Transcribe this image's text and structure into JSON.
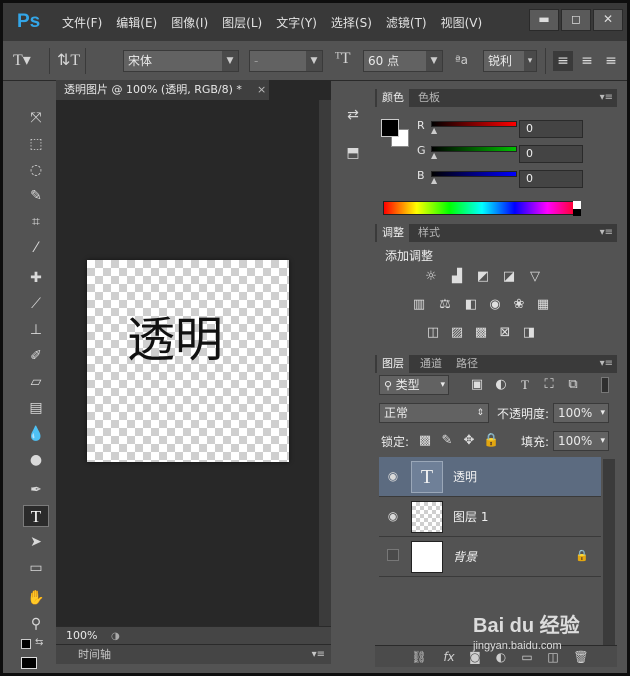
{
  "app": {
    "logo": "Ps"
  },
  "menu": [
    "文件(F)",
    "编辑(E)",
    "图像(I)",
    "图层(L)",
    "文字(Y)",
    "选择(S)",
    "滤镜(T)",
    "视图(V)"
  ],
  "window_controls": {
    "minimize": "▬",
    "restore": "◻",
    "close": "✕"
  },
  "options": {
    "font_family": "宋体",
    "font_style": "-",
    "font_size": "60 点",
    "antialias_icon": "ªa",
    "antialias": "锐利"
  },
  "document": {
    "tab_title": "透明图片 @ 100% (透明, RGB/8) *",
    "close": "×",
    "canvas_text": "透明",
    "zoom": "100%"
  },
  "timeline": {
    "label": "时间轴"
  },
  "color_panel": {
    "tabs": [
      "颜色",
      "色板"
    ],
    "active_tab": 0,
    "channels": [
      {
        "label": "R",
        "value": "0",
        "color": "#ff0000"
      },
      {
        "label": "G",
        "value": "0",
        "color": "#00c000"
      },
      {
        "label": "B",
        "value": "0",
        "color": "#0000ff"
      }
    ],
    "foreground": "#000000",
    "background": "#ffffff"
  },
  "adjust_panel": {
    "tabs": [
      "调整",
      "样式"
    ],
    "active_tab": 0,
    "title": "添加调整",
    "row1": [
      "sun-icon",
      "levels-icon",
      "curves-icon",
      "exposure-icon",
      "triangle-down-icon"
    ],
    "row2": [
      "hue-icon",
      "balance-icon",
      "bw-icon",
      "camera-icon",
      "mixer-icon",
      "grid-icon"
    ],
    "row3": [
      "invert-icon",
      "posterize-icon",
      "threshold-icon",
      "selective-icon",
      "gradient-map-icon"
    ]
  },
  "layers_panel": {
    "tabs": [
      "图层",
      "通道",
      "路径"
    ],
    "active_tab": 0,
    "filter_kind": "类型",
    "blend_mode": "正常",
    "opacity_label": "不透明度:",
    "opacity": "100%",
    "lock_label": "锁定:",
    "fill_label": "填充:",
    "fill": "100%",
    "layers": [
      {
        "name": "透明",
        "type": "text",
        "visible": true,
        "selected": true,
        "thumb_label": "T"
      },
      {
        "name": "图层 1",
        "type": "transparent",
        "visible": true,
        "selected": false
      },
      {
        "name": "背景",
        "type": "background",
        "visible": false,
        "selected": false,
        "locked": true
      }
    ]
  },
  "watermark": {
    "text": "Bai du 经验",
    "url": "jingyan.baidu.com"
  }
}
